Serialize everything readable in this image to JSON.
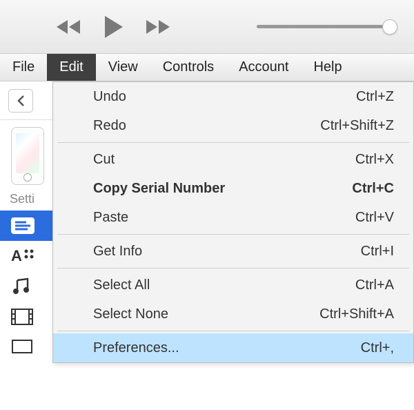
{
  "menubar": {
    "file": "File",
    "edit": "Edit",
    "view": "View",
    "controls": "Controls",
    "account": "Account",
    "help": "Help"
  },
  "sidebar": {
    "settings_label": "Setti"
  },
  "dropdown": {
    "undo": {
      "label": "Undo",
      "shortcut": "Ctrl+Z"
    },
    "redo": {
      "label": "Redo",
      "shortcut": "Ctrl+Shift+Z"
    },
    "cut": {
      "label": "Cut",
      "shortcut": "Ctrl+X"
    },
    "copy_serial": {
      "label": "Copy Serial Number",
      "shortcut": "Ctrl+C"
    },
    "paste": {
      "label": "Paste",
      "shortcut": "Ctrl+V"
    },
    "get_info": {
      "label": "Get Info",
      "shortcut": "Ctrl+I"
    },
    "select_all": {
      "label": "Select All",
      "shortcut": "Ctrl+A"
    },
    "select_none": {
      "label": "Select None",
      "shortcut": "Ctrl+Shift+A"
    },
    "preferences": {
      "label": "Preferences...",
      "shortcut": "Ctrl+,"
    }
  }
}
